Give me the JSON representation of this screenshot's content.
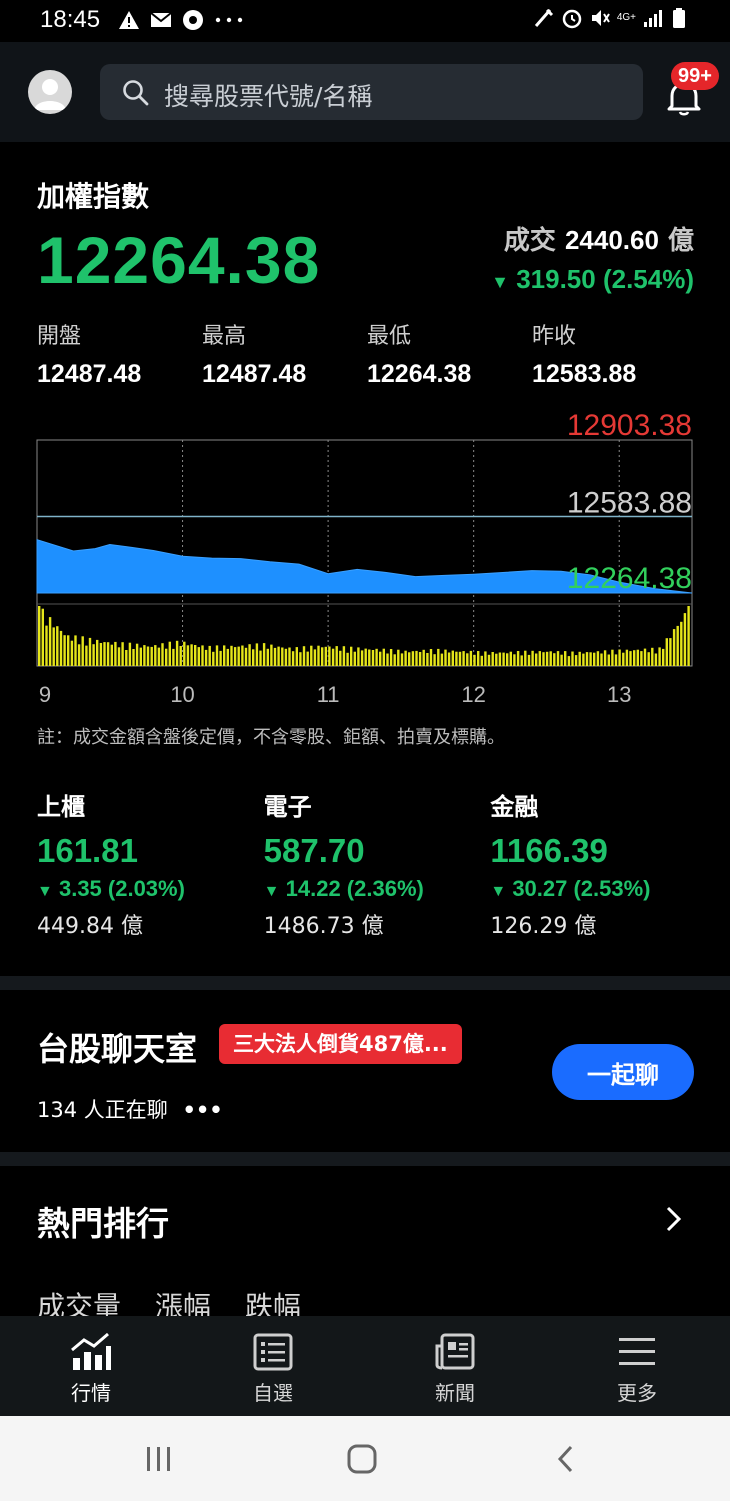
{
  "status_bar": {
    "time": "18:45",
    "network": "4G+",
    "icons": [
      "alert-icon",
      "mail-icon",
      "chrome-icon",
      "more-dots-icon",
      "nfc-icon",
      "alarm-icon",
      "mute-icon",
      "signal-icon",
      "battery-icon"
    ]
  },
  "header": {
    "search_placeholder": "搜尋股票代號/名稱",
    "notification_badge": "99+"
  },
  "index": {
    "name": "加權指數",
    "value": "12264.38",
    "volume_label": "成交",
    "volume_value": "2440.60",
    "volume_unit": "億",
    "change": "319.50 (2.54%)",
    "stats": [
      {
        "label": "開盤",
        "value": "12487.48"
      },
      {
        "label": "最高",
        "value": "12487.48"
      },
      {
        "label": "最低",
        "value": "12264.38"
      },
      {
        "label": "昨收",
        "value": "12583.88"
      }
    ]
  },
  "chart_data": {
    "type": "area",
    "title": "",
    "xlabel": "",
    "ylabel": "",
    "x_ticks": [
      "9",
      "10",
      "11",
      "12",
      "13"
    ],
    "y_labels": {
      "upper_limit": "12903.38",
      "previous_close": "12583.88",
      "current": "12264.38"
    },
    "ylim": [
      12264.38,
      12903.38
    ],
    "price_series": {
      "name": "",
      "x": [
        9.0,
        9.25,
        9.4,
        9.5,
        9.65,
        9.8,
        10.0,
        10.2,
        10.4,
        10.6,
        10.8,
        11.0,
        11.2,
        11.4,
        11.6,
        11.8,
        12.0,
        12.2,
        12.4,
        12.6,
        12.8,
        13.0,
        13.25,
        13.5
      ],
      "y": [
        12487,
        12440,
        12450,
        12467,
        12455,
        12442,
        12418,
        12410,
        12408,
        12395,
        12385,
        12345,
        12363,
        12350,
        12333,
        12338,
        12343,
        12350,
        12358,
        12355,
        12340,
        12310,
        12282,
        12264.38
      ]
    },
    "volume_series": {
      "name": "",
      "relative_values": [
        0.85,
        0.45,
        0.38,
        0.33,
        0.3,
        0.36,
        0.28,
        0.3,
        0.32,
        0.26,
        0.3,
        0.27,
        0.25,
        0.22,
        0.24,
        0.22,
        0.2,
        0.21,
        0.22,
        0.2,
        0.22,
        0.24,
        0.26,
        0.85
      ]
    },
    "colors": {
      "price_fill": "#1e90ff",
      "volume": "#e6e61a",
      "upper": "#e53935",
      "previous": "#cfcfcf",
      "current": "#32d05c"
    }
  },
  "chart_note": "註：成交金額含盤後定價，不含零股、鉅額、拍賣及標購。",
  "sub_indices": [
    {
      "name": "上櫃",
      "value": "161.81",
      "change": "3.35 (2.03%)",
      "volume": "449.84 億"
    },
    {
      "name": "電子",
      "value": "587.70",
      "change": "14.22 (2.36%)",
      "volume": "1486.73 億"
    },
    {
      "name": "金融",
      "value": "1166.39",
      "change": "30.27 (2.53%)",
      "volume": "126.29 億"
    }
  ],
  "chat": {
    "title": "台股聊天室",
    "tag": "三大法人倒貨487億...",
    "count": "134 人正在聊",
    "button": "一起聊"
  },
  "hot": {
    "title": "熱門排行",
    "tabs": [
      "成交量",
      "漲幅",
      "跌幅"
    ]
  },
  "tabbar": [
    {
      "label": "行情",
      "icon": "chart-icon"
    },
    {
      "label": "自選",
      "icon": "list-icon"
    },
    {
      "label": "新聞",
      "icon": "news-icon"
    },
    {
      "label": "更多",
      "icon": "menu-icon"
    }
  ],
  "colors": {
    "up_green": "#1fc26b",
    "accent_blue": "#1a6cff",
    "tag_red": "#e82c33"
  }
}
